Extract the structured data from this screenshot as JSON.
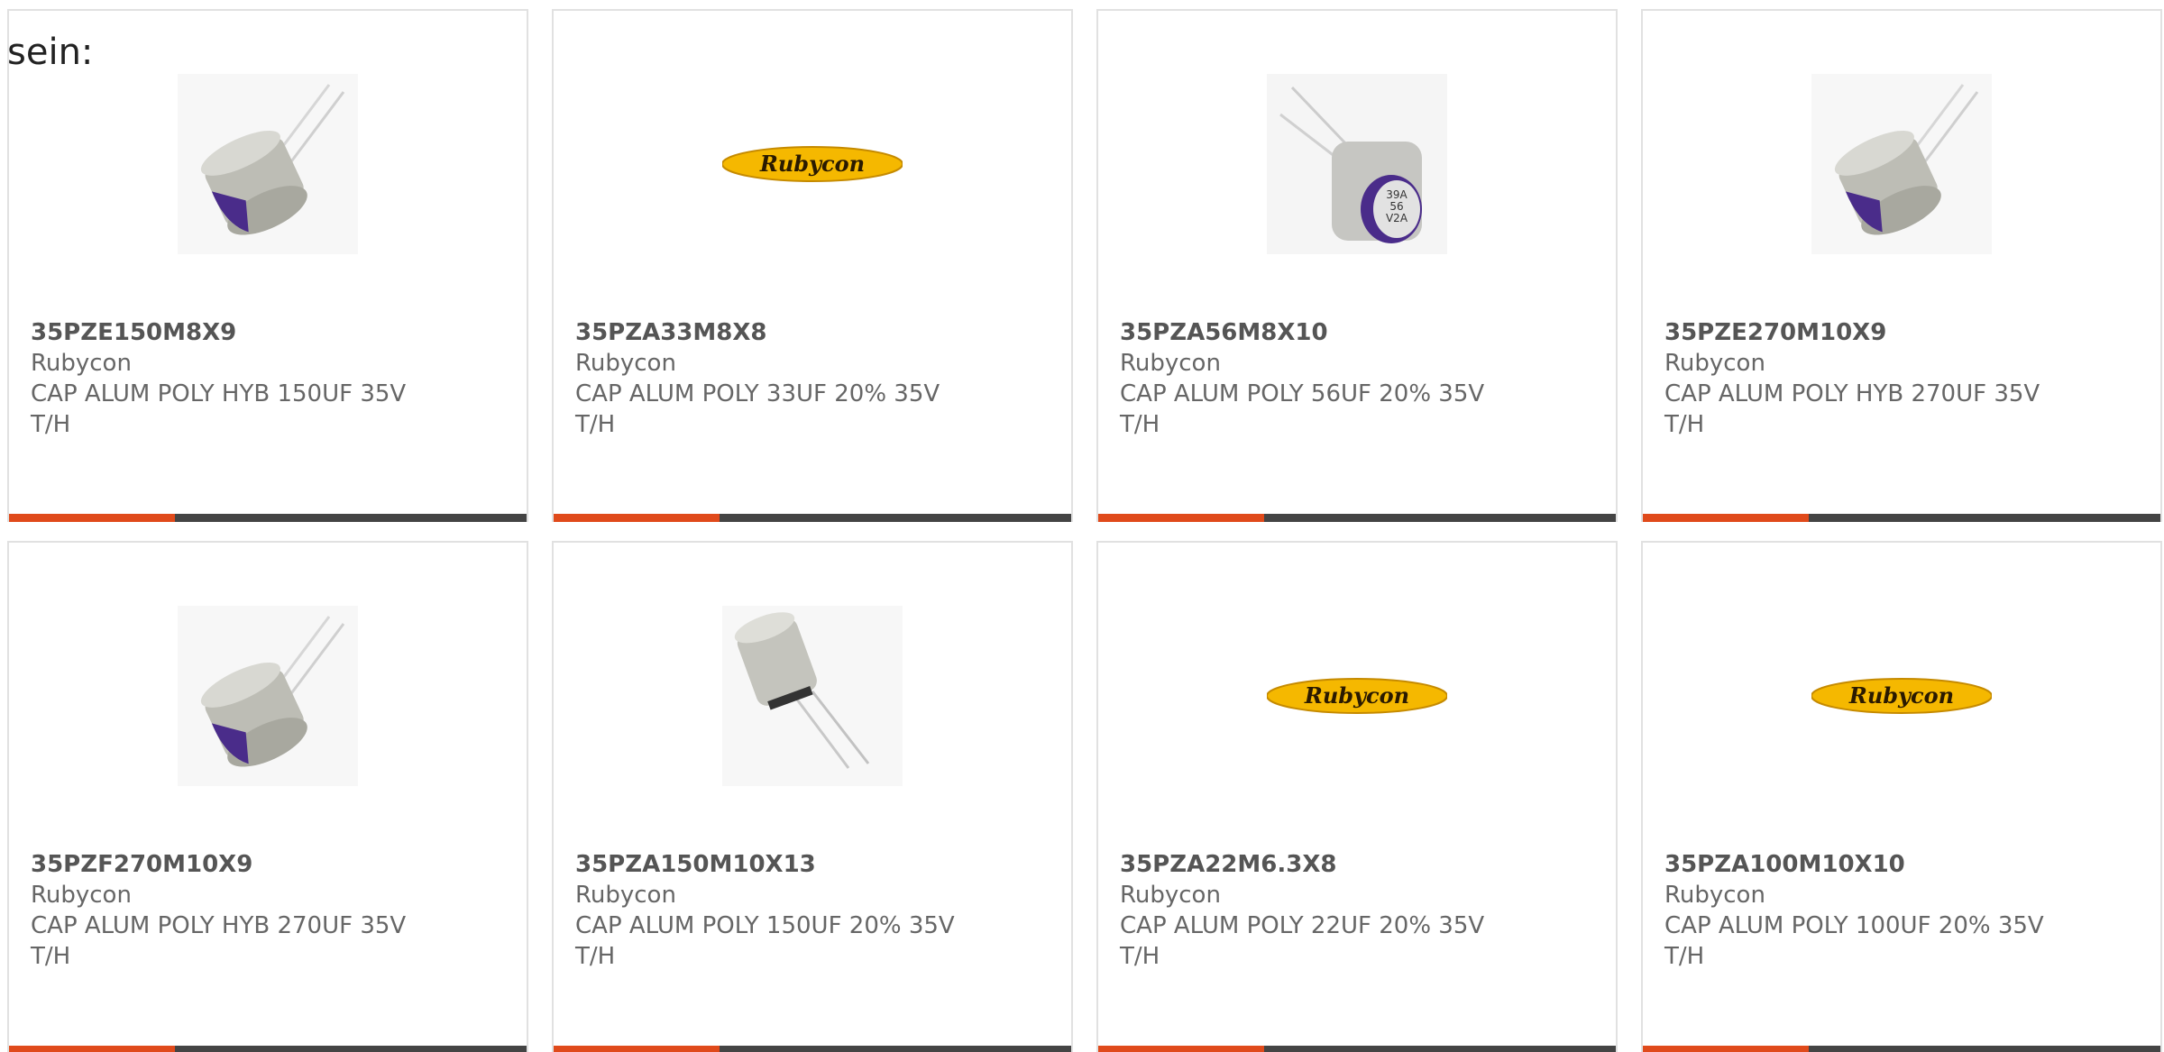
{
  "intro_text": "sein:",
  "colors": {
    "accent": "#e04a1b",
    "bar_dark": "#444444",
    "card_border": "#e1e1e1",
    "text": "#666666",
    "logo_yellow": "#f5b800"
  },
  "products": [
    {
      "part": "35PZE150M8X9",
      "brand": "Rubycon",
      "desc_line1": "CAP ALUM POLY HYB 150UF 35V",
      "desc_line2": "T/H",
      "image": "capacitor-purple-tilted"
    },
    {
      "part": "35PZA33M8X8",
      "brand": "Rubycon",
      "desc_line1": "CAP ALUM POLY 33UF 20% 35V",
      "desc_line2": "T/H",
      "image": "rubycon-logo"
    },
    {
      "part": "35PZA56M8X10",
      "brand": "Rubycon",
      "desc_line1": "CAP ALUM POLY 56UF 20% 35V",
      "desc_line2": "T/H",
      "image": "capacitor-labeled-front",
      "image_label": "39A 56 V2A"
    },
    {
      "part": "35PZE270M10X9",
      "brand": "Rubycon",
      "desc_line1": "CAP ALUM POLY HYB 270UF 35V",
      "desc_line2": "T/H",
      "image": "capacitor-purple-tilted"
    },
    {
      "part": "35PZF270M10X9",
      "brand": "Rubycon",
      "desc_line1": "CAP ALUM POLY HYB 270UF 35V",
      "desc_line2": "T/H",
      "image": "capacitor-purple-tilted"
    },
    {
      "part": "35PZA150M10X13",
      "brand": "Rubycon",
      "desc_line1": "CAP ALUM POLY 150UF 20% 35V",
      "desc_line2": "T/H",
      "image": "capacitor-leads-down"
    },
    {
      "part": "35PZA22M6.3X8",
      "brand": "Rubycon",
      "desc_line1": "CAP ALUM POLY 22UF 20% 35V",
      "desc_line2": "T/H",
      "image": "rubycon-logo"
    },
    {
      "part": "35PZA100M10X10",
      "brand": "Rubycon",
      "desc_line1": "CAP ALUM POLY 100UF 20% 35V",
      "desc_line2": "T/H",
      "image": "rubycon-logo"
    }
  ],
  "logo_text": "Rubycon"
}
